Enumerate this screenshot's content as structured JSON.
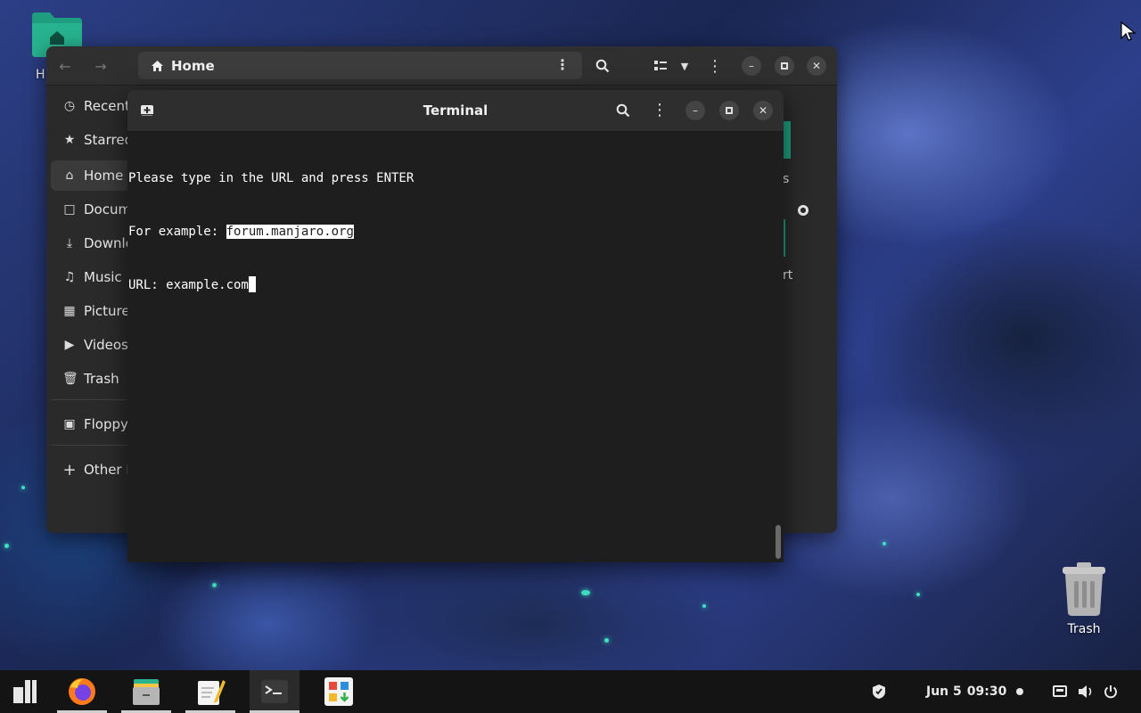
{
  "desktop": {
    "home_icon_label": "H",
    "trash_icon_label": "Trash",
    "peek_labels": [
      "s",
      "rt"
    ]
  },
  "file_manager": {
    "path": "Home",
    "sidebar": [
      {
        "label": "Recent",
        "icon": "clock-icon"
      },
      {
        "label": "Starred",
        "icon": "star-icon"
      },
      {
        "label": "Home",
        "icon": "home-icon",
        "active": true
      },
      {
        "label": "Documents",
        "icon": "document-icon"
      },
      {
        "label": "Downloads",
        "icon": "download-icon"
      },
      {
        "label": "Music",
        "icon": "music-icon"
      },
      {
        "label": "Pictures",
        "icon": "picture-icon"
      },
      {
        "label": "Videos",
        "icon": "video-icon"
      },
      {
        "label": "Trash",
        "icon": "trash-icon"
      },
      {
        "label": "Floppy",
        "icon": "floppy-icon"
      },
      {
        "label": "Other Locations",
        "icon": "plus-icon"
      }
    ]
  },
  "terminal": {
    "title": "Terminal",
    "line1": "Please type in the URL and press ENTER",
    "line2_prefix": "For example: ",
    "line2_highlight": "forum.manjaro.org",
    "line3": "URL: example.com"
  },
  "taskbar": {
    "apps": [
      "menu-icon",
      "firefox-icon",
      "files-icon",
      "text-editor-icon",
      "terminal-icon",
      "software-icon"
    ],
    "date": "Jun 5",
    "time": "09:30"
  }
}
